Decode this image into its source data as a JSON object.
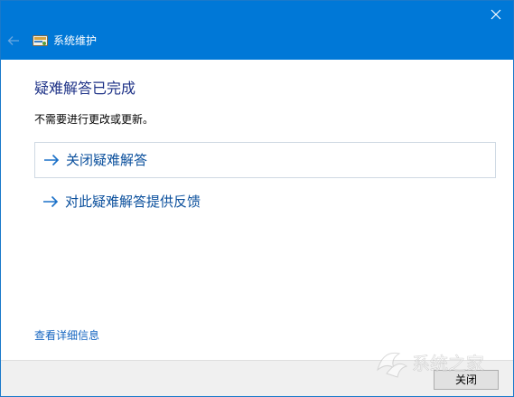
{
  "window": {
    "title": "系统维护"
  },
  "content": {
    "heading": "疑难解答已完成",
    "message": "不需要进行更改或更新。"
  },
  "actions": [
    {
      "label": "关闭疑难解答"
    },
    {
      "label": "对此疑难解答提供反馈"
    }
  ],
  "footer": {
    "details_link": "查看详细信息",
    "close_button": "关闭"
  },
  "watermark": {
    "text": "系统之家"
  },
  "colors": {
    "titlebar": "#0078d7",
    "heading": "#1e3287",
    "link": "#0a4f9c",
    "footer": "#f0f0f0"
  },
  "icons": {
    "close": "close-icon",
    "back": "back-arrow-icon",
    "app": "maintenance-icon",
    "action_arrow": "arrow-right-icon"
  }
}
